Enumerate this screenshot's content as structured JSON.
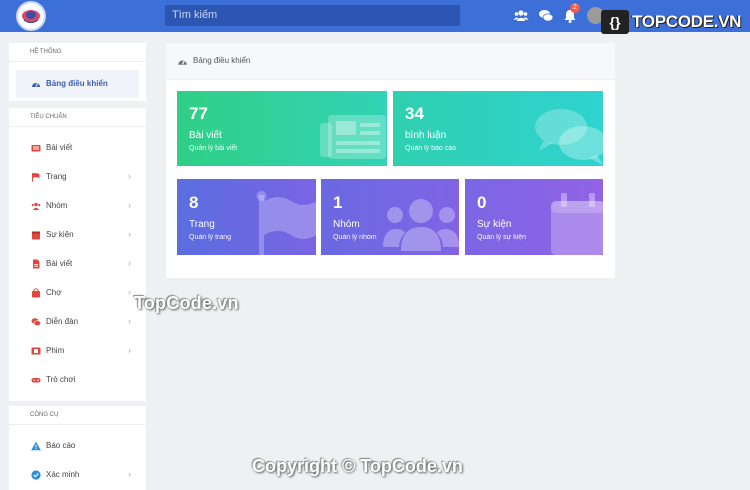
{
  "header": {
    "search_placeholder": "Tìm kiếm",
    "notification_count": "2",
    "brand_mark": "{}",
    "brand_text": "TOPCODE.VN"
  },
  "sidebar": {
    "system": {
      "title": "HỆ THỐNG",
      "items": [
        {
          "label": "Bảng điều khiển",
          "icon": "dashboard-icon"
        }
      ]
    },
    "standard": {
      "title": "TIÊU CHUẨN",
      "items": [
        {
          "label": "Bài viết",
          "icon": "newspaper-icon",
          "has_submenu": false
        },
        {
          "label": "Trang",
          "icon": "flag-icon",
          "has_submenu": true
        },
        {
          "label": "Nhóm",
          "icon": "users-icon",
          "has_submenu": true
        },
        {
          "label": "Sự kiện",
          "icon": "calendar-icon",
          "has_submenu": true
        },
        {
          "label": "Bài viết",
          "icon": "file-icon",
          "has_submenu": true
        },
        {
          "label": "Chợ",
          "icon": "shopping-bag-icon",
          "has_submenu": true
        },
        {
          "label": "Diễn đàn",
          "icon": "comments-icon",
          "has_submenu": true
        },
        {
          "label": "Phim",
          "icon": "film-icon",
          "has_submenu": true
        },
        {
          "label": "Trò chơi",
          "icon": "gamepad-icon",
          "has_submenu": false
        }
      ]
    },
    "tools": {
      "title": "CÔNG CỤ",
      "items": [
        {
          "label": "Báo cáo",
          "icon": "warning-icon",
          "has_submenu": false
        },
        {
          "label": "Xác minh",
          "icon": "check-circle-icon",
          "has_submenu": true
        }
      ]
    }
  },
  "main": {
    "title": "Bảng điều khiển",
    "stats": [
      {
        "number": "77",
        "label": "Bài viết",
        "sub": "Quản lý bài viết",
        "icon": "newspaper-icon"
      },
      {
        "number": "34",
        "label": "bình luận",
        "sub": "Quản lý báo cáo",
        "icon": "comments-icon"
      },
      {
        "number": "8",
        "label": "Trang",
        "sub": "Quản lý trang",
        "icon": "flag-icon"
      },
      {
        "number": "1",
        "label": "Nhóm",
        "sub": "Quản lý nhóm",
        "icon": "users-icon"
      },
      {
        "number": "0",
        "label": "Sự kiện",
        "sub": "Quản lý sự kiện",
        "icon": "calendar-icon"
      }
    ]
  },
  "watermarks": {
    "middle": "TopCode.vn",
    "bottom": "Copyright © TopCode.vn"
  },
  "colors": {
    "topbar": "#3d6fd9",
    "green_gradient_start": "#2fcf86",
    "green_gradient_end": "#2fd3c4",
    "purple_gradient_start": "#5a6ee0",
    "purple_gradient_end": "#8a63e6",
    "active_nav": "#3c5fb0"
  }
}
